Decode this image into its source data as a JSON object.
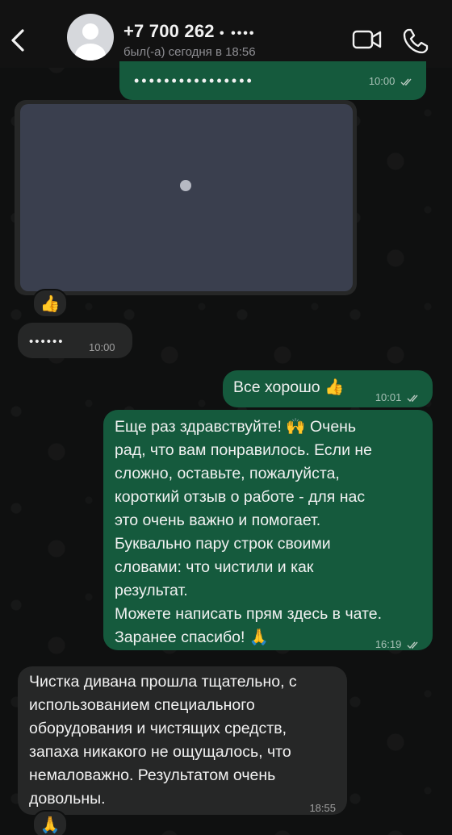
{
  "header": {
    "contact_name": "+7 700 262 ",
    "contact_name_masked": "• ••••",
    "status": "был(-а) сегодня в 18:56",
    "back_icon": "chevron-left-icon",
    "video_icon": "video-camera-icon",
    "call_icon": "phone-icon"
  },
  "messages": [
    {
      "id": "m1",
      "direction": "out",
      "text": "••••••••••••••••",
      "time": "10:00",
      "read": true
    },
    {
      "id": "m2",
      "direction": "in",
      "type": "media",
      "reaction": "👍"
    },
    {
      "id": "m3",
      "direction": "in",
      "text": "••••••",
      "time": "10:00"
    },
    {
      "id": "m4",
      "direction": "out",
      "text": "Все хорошо 👍",
      "time": "10:01",
      "read": true
    },
    {
      "id": "m5",
      "direction": "out",
      "text": "Еще раз здравствуйте! 🙌 Очень\nрад, что вам понравилось. Если не\nсложно, оставьте, пожалуйста,\nкороткий отзыв о работе - для нас\nэто очень важно и помогает.\nБуквально пару строк своими\nсловами: что чистили и как\nрезультат.\nМожете написать прям здесь в чате.\nЗаранее спасибо! 🙏",
      "time": "16:19",
      "read": true
    },
    {
      "id": "m6",
      "direction": "in",
      "text": "Чистка дивана прошла тщательно, с\nиспользованием специального\nоборудования и чистящих средств,\nзапаха никакого не ощущалось, что\nнемаловажно. Результатом очень\nдовольны.",
      "time": "18:55",
      "reaction": "🙏"
    }
  ],
  "colors": {
    "outgoing_bubble": "#155a3d",
    "incoming_bubble": "#262727",
    "background": "#0f1010"
  }
}
